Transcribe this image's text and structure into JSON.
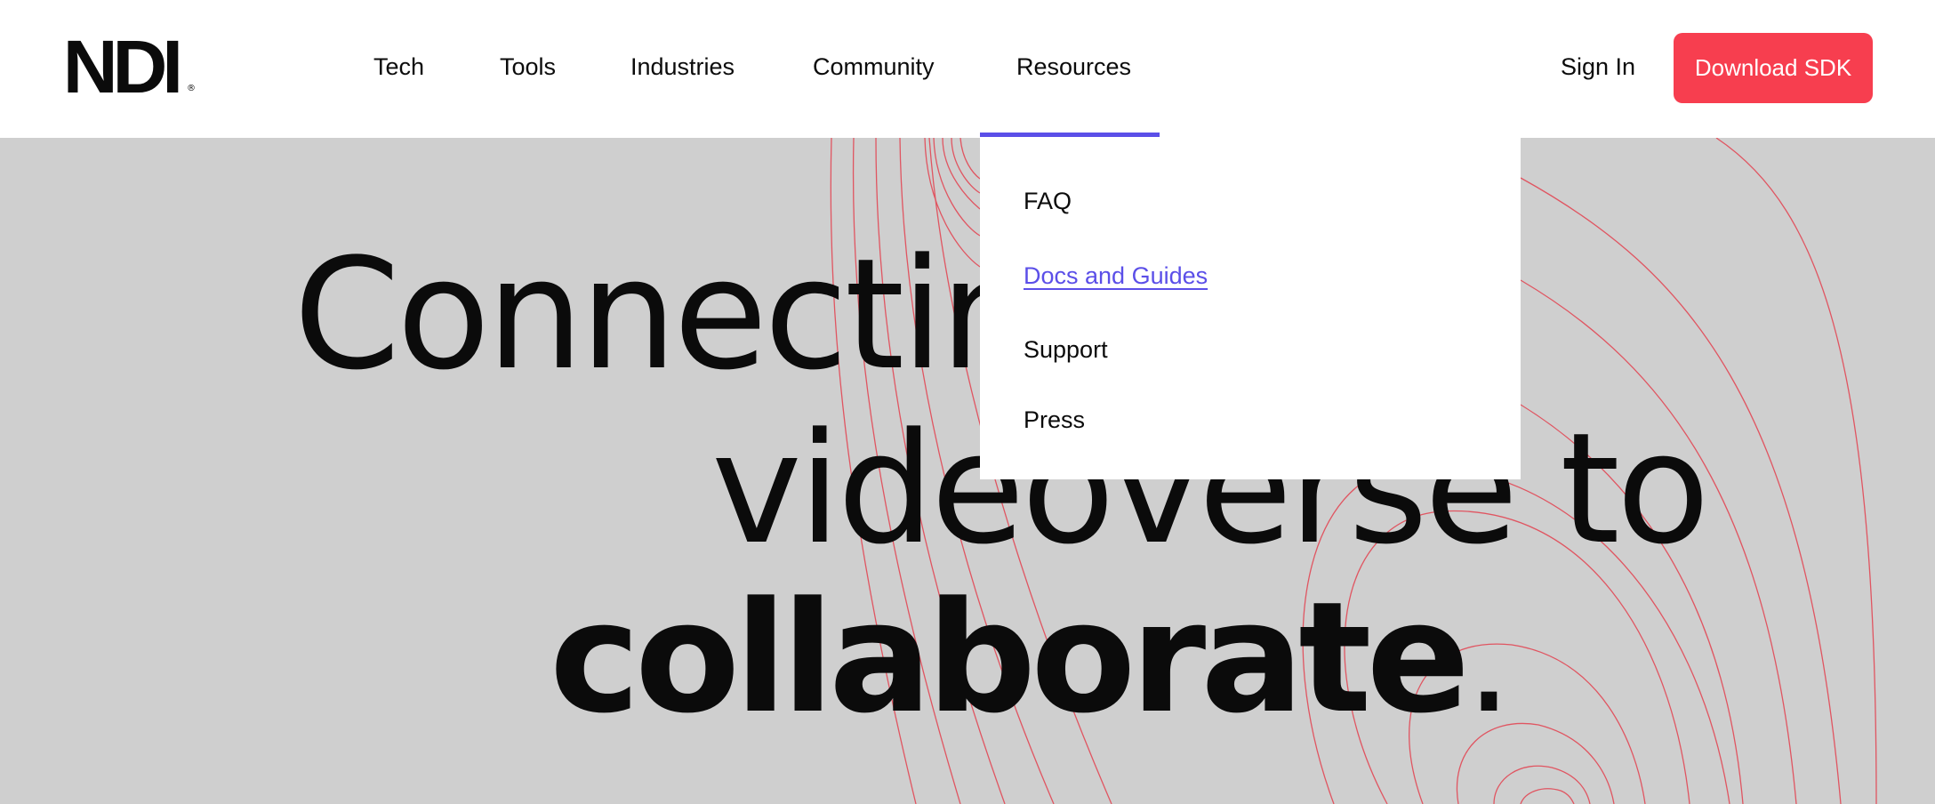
{
  "header": {
    "logo_text": "NDI",
    "logo_mark": "®",
    "nav": [
      {
        "label": "Tech"
      },
      {
        "label": "Tools"
      },
      {
        "label": "Industries"
      },
      {
        "label": "Community"
      },
      {
        "label": "Resources"
      }
    ],
    "active_nav": "Resources",
    "sign_in": "Sign In",
    "download": "Download SDK"
  },
  "dropdown": {
    "items": [
      {
        "label": "FAQ"
      },
      {
        "label": "Docs and Guides"
      },
      {
        "label": "Support"
      },
      {
        "label": "Press"
      }
    ],
    "active_item": "Docs and Guides"
  },
  "hero": {
    "line1": "Connecting the",
    "line2": "videoverse to",
    "line3_bold": "collaborate",
    "line3_punct": "."
  },
  "colors": {
    "accent": "#5b4fe8",
    "cta": "#f73e4f",
    "hero_bg": "#cfcfcf",
    "contour": "#e05561"
  }
}
